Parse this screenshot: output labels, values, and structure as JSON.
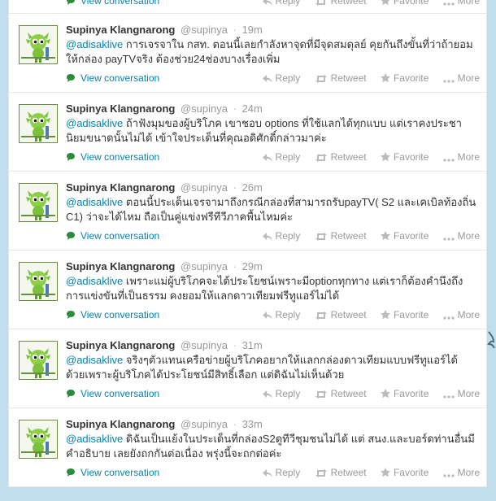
{
  "actions": {
    "reply": "Reply",
    "retweet": "Retweet",
    "favorite": "Favorite",
    "more": "More"
  },
  "expand_label": "View conversation",
  "icons": [
    "chat-bubble-icon",
    "reply-icon",
    "retweet-icon",
    "favorite-star-icon",
    "more-dots-icon"
  ],
  "colors": {
    "link": "#0084b4",
    "page_bg": "#c0deed",
    "meta": "#999999",
    "expand_icon": "#2c8b3c"
  },
  "tweets": [
    {
      "fullname": "Supinya Klangnarong",
      "username": "@supinya",
      "time": "19m",
      "mention": "@adisaklive",
      "text": " การเจรจาใน กสท. ตอนนี้เลยกำลังหาจุดที่มีจุดสมดุลย์ คุยกันถึงขั้นที่ว่าถ้ายอมให้กล่อง payTVจริง ต้องช่วย24ช่องบางเรื่องเพิ่ม"
    },
    {
      "fullname": "Supinya Klangnarong",
      "username": "@supinya",
      "time": "24m",
      "mention": "@adisaklive",
      "text": " ถ้าฟังมุมของผู้บริโภค เขาชอบ options ที่ใช้แลกได้ทุกแบบ แต่เราคงประชานิยมขนาดนั้นไม่ได้ เข้าใจประเด็นที่คุณอดิศักดิ์กล่าวมาค่ะ"
    },
    {
      "fullname": "Supinya Klangnarong",
      "username": "@supinya",
      "time": "26m",
      "mention": "@adisaklive",
      "text": " ตอนนี้ประเด็นเจรจามาถึงกรณีกล่องที่สามารถรับpayTV( S2 และเคเบิลท้องถิ่น C1) ว่าจะได้ไหม ถือเป็นคู่แข่งฟรีทีวีภาคพื้นไหมค่ะ"
    },
    {
      "fullname": "Supinya Klangnarong",
      "username": "@supinya",
      "time": "29m",
      "mention": "@adisaklive",
      "text": " เพราะแม่ผู้บริโภคจะได้ประโยชน์เพราะมีoptionทุกทาง แต่เราก็ต้องคำนึงถึงการแข่งขันที่เป็นธรรม คงยอมให้แลกดาวเทียมฟรีทูแอร์ไม่ได้"
    },
    {
      "fullname": "Supinya Klangnarong",
      "username": "@supinya",
      "time": "31m",
      "mention": "@adisaklive",
      "text": " จริงๆตัวแทนเครือข่ายผู้บริโภคอยากให้แลกกล่องดาวเทียมแบบฟรีทูแอร์ได้ด้วยเพราะผู้บริโภคได้ประโยชน์มีสิทธิ์เลือก แต่ดิฉันไม่เห็นด้วย"
    },
    {
      "fullname": "Supinya Klangnarong",
      "username": "@supinya",
      "time": "33m",
      "mention": "@adisaklive",
      "text": " ดิฉันเป็นแย้งในประเด็นที่กล่องS2ดูทีวีชุมชนไม่ได้ แต่ สนง.และบอร์ดท่านอื่นมีคำอธิบาย เลยยังถกกันต่อเนื่อง พรุ่งนี้จะถกต่อค่ะ"
    }
  ]
}
